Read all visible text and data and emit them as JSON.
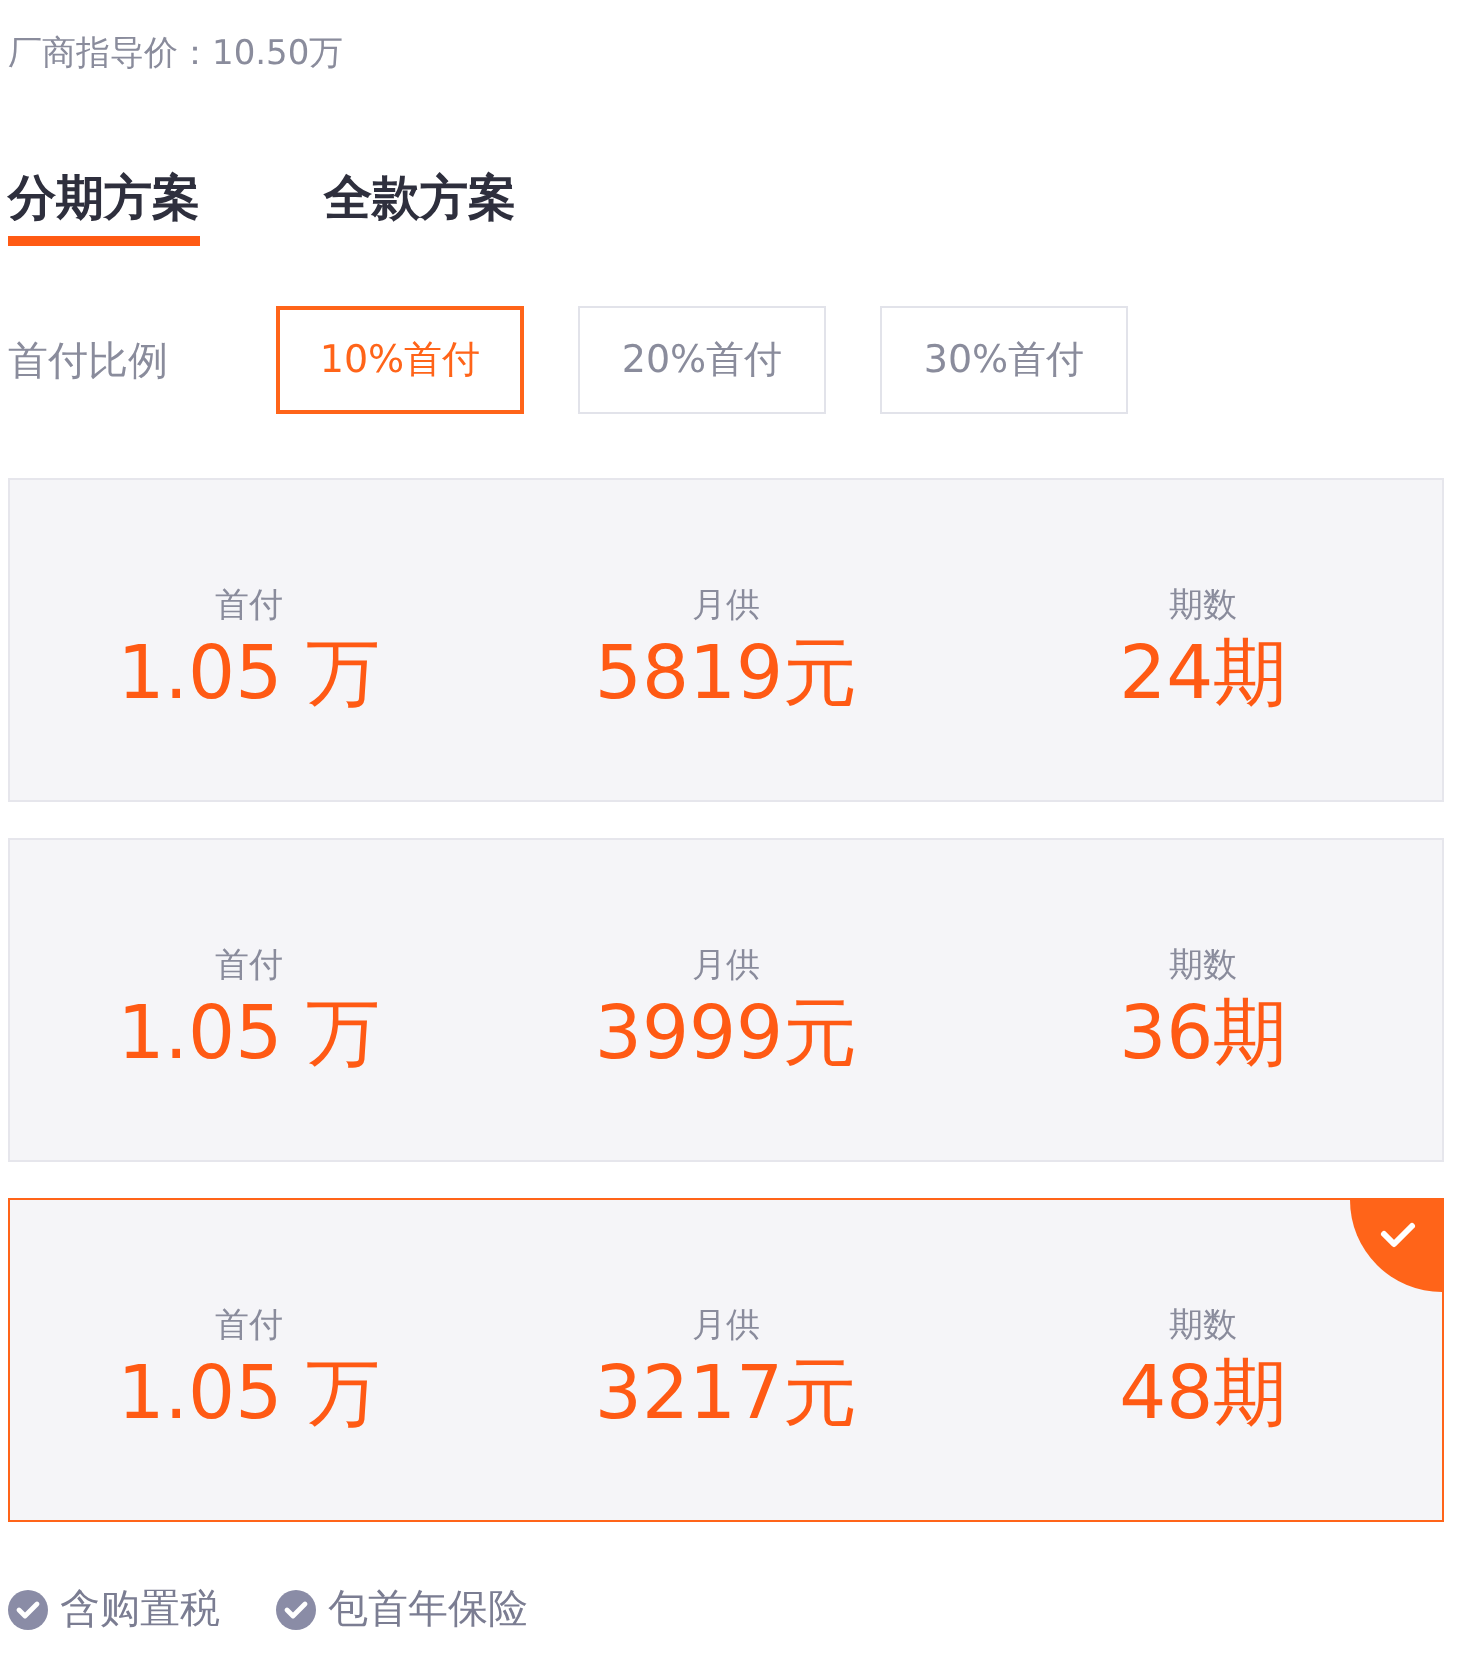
{
  "guide_price": "厂商指导价：10.50万",
  "tabs": [
    {
      "label": "分期方案",
      "selected": true
    },
    {
      "label": "全款方案",
      "selected": false
    }
  ],
  "down_payment": {
    "label": "首付比例",
    "options": [
      {
        "label": "10%首付",
        "selected": true
      },
      {
        "label": "20%首付",
        "selected": false
      },
      {
        "label": "30%首付",
        "selected": false
      }
    ]
  },
  "plans": [
    {
      "selected": false,
      "fields": [
        {
          "label": "首付",
          "value": "1.05 万"
        },
        {
          "label": "月供",
          "value": "5819元"
        },
        {
          "label": "期数",
          "value": "24期"
        }
      ]
    },
    {
      "selected": false,
      "fields": [
        {
          "label": "首付",
          "value": "1.05 万"
        },
        {
          "label": "月供",
          "value": "3999元"
        },
        {
          "label": "期数",
          "value": "36期"
        }
      ]
    },
    {
      "selected": true,
      "fields": [
        {
          "label": "首付",
          "value": "1.05 万"
        },
        {
          "label": "月供",
          "value": "3217元"
        },
        {
          "label": "期数",
          "value": "48期"
        }
      ]
    }
  ],
  "features": [
    "含购置税",
    "包首年保险"
  ]
}
